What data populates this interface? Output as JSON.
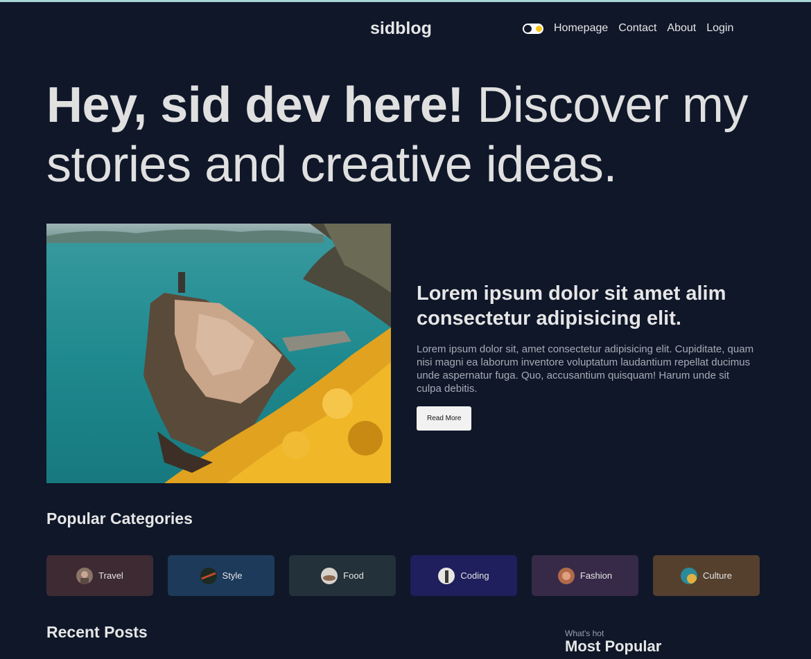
{
  "brand": {
    "logo": "sidblog"
  },
  "nav": {
    "links": [
      "Homepage",
      "Contact",
      "About",
      "Login"
    ]
  },
  "hero": {
    "bold": "Hey, sid dev here!",
    "rest": " Discover my stories and creative ideas."
  },
  "featured": {
    "title": "Lorem ipsum dolor sit amet alim consectetur adipisicing elit.",
    "description": "Lorem ipsum dolor sit, amet consectetur adipisicing elit. Cupiditate, quam nisi magni ea laborum inventore voluptatum laudantium repellat ducimus unde aspernatur fuga. Quo, accusantium quisquam! Harum unde sit culpa debitis.",
    "button": "Read More"
  },
  "categories": {
    "title": "Popular Categories",
    "items": [
      {
        "label": "Travel",
        "color": "#3d2a33"
      },
      {
        "label": "Style",
        "color": "#1e3a5a"
      },
      {
        "label": "Food",
        "color": "#22313a"
      },
      {
        "label": "Coding",
        "color": "#1e1f5c"
      },
      {
        "label": "Fashion",
        "color": "#362a48"
      },
      {
        "label": "Culture",
        "color": "#55402e"
      }
    ]
  },
  "recent": {
    "title": "Recent Posts"
  },
  "popular": {
    "label": "What's hot",
    "title": "Most Popular"
  }
}
